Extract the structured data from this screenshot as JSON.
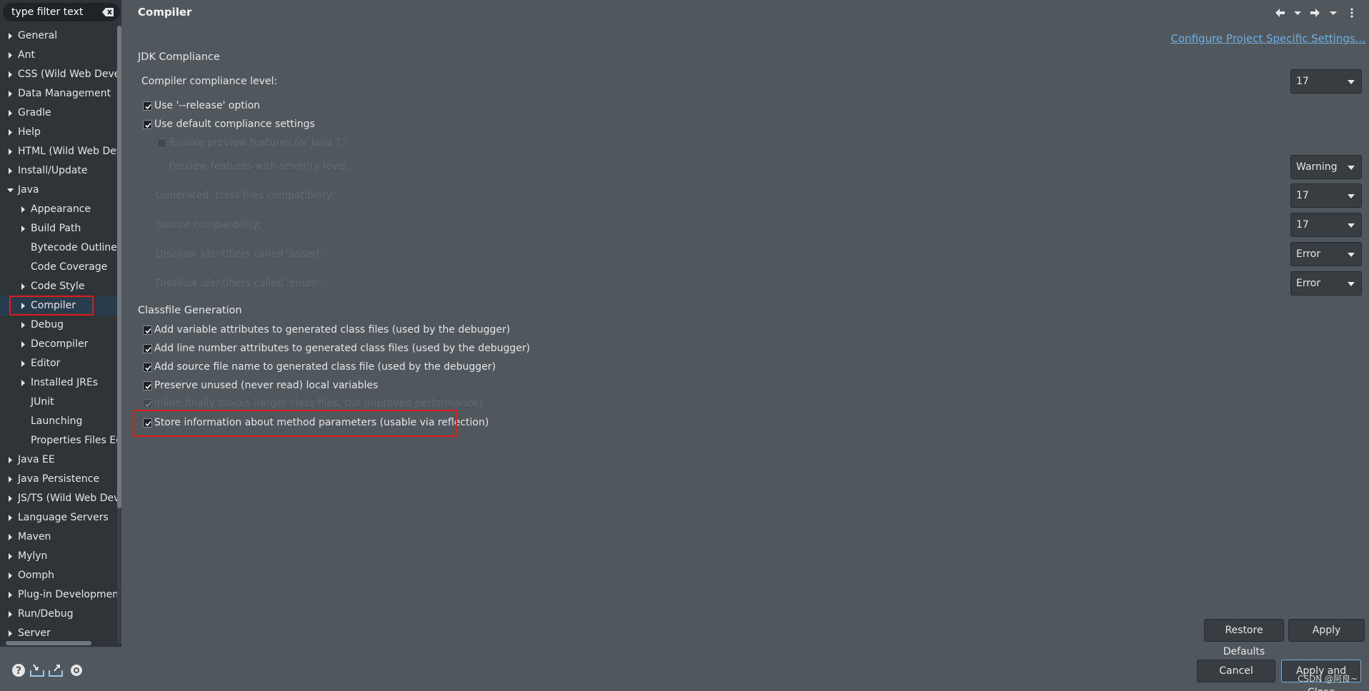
{
  "filter": {
    "placeholder": "type filter text"
  },
  "tree": [
    {
      "label": "General",
      "level": 0,
      "expander": "closed"
    },
    {
      "label": "Ant",
      "level": 0,
      "expander": "closed"
    },
    {
      "label": "CSS (Wild Web Developer)",
      "level": 0,
      "expander": "closed"
    },
    {
      "label": "Data Management",
      "level": 0,
      "expander": "closed"
    },
    {
      "label": "Gradle",
      "level": 0,
      "expander": "closed"
    },
    {
      "label": "Help",
      "level": 0,
      "expander": "closed"
    },
    {
      "label": "HTML (Wild Web Developer)",
      "level": 0,
      "expander": "closed"
    },
    {
      "label": "Install/Update",
      "level": 0,
      "expander": "closed"
    },
    {
      "label": "Java",
      "level": 0,
      "expander": "open"
    },
    {
      "label": "Appearance",
      "level": 1,
      "expander": "closed"
    },
    {
      "label": "Build Path",
      "level": 1,
      "expander": "closed"
    },
    {
      "label": "Bytecode Outline",
      "level": 1,
      "expander": "none"
    },
    {
      "label": "Code Coverage",
      "level": 1,
      "expander": "none"
    },
    {
      "label": "Code Style",
      "level": 1,
      "expander": "closed"
    },
    {
      "label": "Compiler",
      "level": 1,
      "expander": "closed",
      "selected": true
    },
    {
      "label": "Debug",
      "level": 1,
      "expander": "closed"
    },
    {
      "label": "Decompiler",
      "level": 1,
      "expander": "closed"
    },
    {
      "label": "Editor",
      "level": 1,
      "expander": "closed"
    },
    {
      "label": "Installed JREs",
      "level": 1,
      "expander": "closed"
    },
    {
      "label": "JUnit",
      "level": 1,
      "expander": "none"
    },
    {
      "label": "Launching",
      "level": 1,
      "expander": "none"
    },
    {
      "label": "Properties Files Editor",
      "level": 1,
      "expander": "none"
    },
    {
      "label": "Java EE",
      "level": 0,
      "expander": "closed"
    },
    {
      "label": "Java Persistence",
      "level": 0,
      "expander": "closed"
    },
    {
      "label": "JS/TS (Wild Web Developer)",
      "level": 0,
      "expander": "closed"
    },
    {
      "label": "Language Servers",
      "level": 0,
      "expander": "closed"
    },
    {
      "label": "Maven",
      "level": 0,
      "expander": "closed"
    },
    {
      "label": "Mylyn",
      "level": 0,
      "expander": "closed"
    },
    {
      "label": "Oomph",
      "level": 0,
      "expander": "closed"
    },
    {
      "label": "Plug-in Development",
      "level": 0,
      "expander": "closed"
    },
    {
      "label": "Run/Debug",
      "level": 0,
      "expander": "closed"
    },
    {
      "label": "Server",
      "level": 0,
      "expander": "closed"
    }
  ],
  "page": {
    "title": "Compiler",
    "configure_link": "Configure Project Specific Settings..."
  },
  "jdk": {
    "heading": "JDK Compliance",
    "compliance_label": "Compiler compliance level:",
    "compliance_value": "17",
    "release_label": "Use '--release' option",
    "default_label": "Use default compliance settings",
    "preview_label": "Enable preview features for Java 17",
    "preview_severity_label": "Preview features with severity level:",
    "preview_severity_value": "Warning",
    "class_compat_label": "Generated .class files compatibility:",
    "class_compat_value": "17",
    "source_compat_label": "Source compatibility:",
    "source_compat_value": "17",
    "assert_label": "Disallow identifiers called 'assert':",
    "assert_value": "Error",
    "enum_label": "Disallow identifiers called 'enum':",
    "enum_value": "Error"
  },
  "classfile": {
    "heading": "Classfile Generation",
    "items": [
      {
        "label": "Add variable attributes to generated class files (used by the debugger)",
        "checked": true
      },
      {
        "label": "Add line number attributes to generated class files (used by the debugger)",
        "checked": true
      },
      {
        "label": "Add source file name to generated class file (used by the debugger)",
        "checked": true
      },
      {
        "label": "Preserve unused (never read) local variables",
        "checked": true
      },
      {
        "label": "Inline finally blocks (larger class files, but improved performance)",
        "checked": true,
        "disabled": true
      },
      {
        "label": "Store information about method parameters (usable via reflection)",
        "checked": true
      }
    ]
  },
  "buttons": {
    "restore": "Restore Defaults",
    "apply": "Apply",
    "cancel": "Cancel",
    "apply_close": "Apply and Close"
  },
  "watermark": "CSDN @阿良~",
  "colors": {
    "panel_bg": "#50575d",
    "tree_bg": "#2f3438",
    "selection": "#283c4d",
    "highlight": "#e31b1b",
    "link": "#6fb0e2"
  },
  "icons": [
    "clear-filter-icon",
    "back-icon",
    "forward-icon",
    "view-menu-icon",
    "help-icon",
    "import-icon",
    "export-icon",
    "oomph-icon"
  ]
}
